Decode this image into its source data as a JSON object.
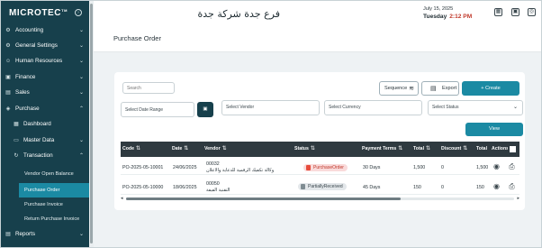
{
  "sidebar": {
    "logo": "MICROTEC",
    "logo_tm": "TM",
    "collapse_icon": "arrow-right-circle-icon",
    "items": [
      {
        "label": "Accounting",
        "icon": "gear-icon"
      },
      {
        "label": "General Settings",
        "icon": "gear-icon"
      },
      {
        "label": "Human Resources",
        "icon": "people-icon"
      },
      {
        "label": "Finance",
        "icon": "wallet-icon"
      },
      {
        "label": "Sales",
        "icon": "chart-icon"
      },
      {
        "label": "Purchase",
        "icon": "cart-icon"
      },
      {
        "label": "Dashboard",
        "icon": "dashboard-icon"
      },
      {
        "label": "Master Data",
        "icon": "folder-icon"
      },
      {
        "label": "Transaction",
        "icon": "refresh-icon"
      },
      {
        "label": "Vendor Open Balance"
      },
      {
        "label": "Purchase Order"
      },
      {
        "label": "Purchase Invoice"
      },
      {
        "label": "Return Purchase Invoice"
      },
      {
        "label": "Reports",
        "icon": "report-icon"
      }
    ]
  },
  "header": {
    "company": "فرع جدة شركة جدة",
    "date": "July 15, 2025",
    "day": "Tuesday",
    "time": "2:12 PM",
    "icons": [
      "grid-icon",
      "calendar-icon",
      "bell-icon"
    ]
  },
  "page": {
    "title": "Purchase Order"
  },
  "toolbar": {
    "search_placeholder": "Search",
    "sequence_label": "Sequence",
    "export_label": "Export",
    "create_label": "+ Create"
  },
  "filters": {
    "date_range": "Select Date Range",
    "vendor": "Select Vendor",
    "currency": "Select Currency",
    "status": "Select Status",
    "view_label": "View"
  },
  "table": {
    "headers": [
      "Code",
      "Date",
      "Vendor",
      "Status",
      "Payment Terms",
      "Total",
      "Discount",
      "Total",
      "Actions"
    ],
    "rows": [
      {
        "code": "PO-2025-05-10001",
        "date": "24/06/2025",
        "vendor_code": "00032",
        "vendor_name": "وكالة تكفيك الرقمية للدعاية والاعلان",
        "status": "PurchaseOrder",
        "payment_terms": "30 Days",
        "total": "1,500",
        "discount": "0",
        "total2": "1,500"
      },
      {
        "code": "PO-2025-05-10000",
        "date": "18/06/2025",
        "vendor_code": "00050",
        "vendor_name": "التقنية الفيفة",
        "status": "PartiallyReceived",
        "payment_terms": "45 Days",
        "total": "150",
        "discount": "0",
        "total2": "150"
      }
    ]
  },
  "colors": {
    "sidebar": "#17404c",
    "accent": "#1b8aa3",
    "status_order": "#f9dada",
    "status_partial": "#e3e7ea"
  }
}
